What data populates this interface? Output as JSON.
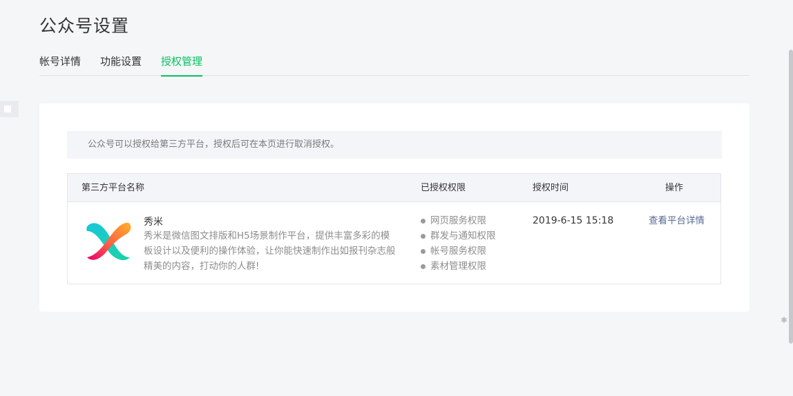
{
  "page": {
    "title": "公众号设置"
  },
  "tabs": [
    {
      "label": "帐号详情",
      "active": false
    },
    {
      "label": "功能设置",
      "active": false
    },
    {
      "label": "授权管理",
      "active": true
    }
  ],
  "notice": "公众号可以授权给第三方平台，授权后可在本页进行取消授权。",
  "table": {
    "headers": {
      "name": "第三方平台名称",
      "permissions": "已授权权限",
      "time": "授权时间",
      "operation": "操作"
    },
    "rows": [
      {
        "logo_icon": "xiumi-logo-icon",
        "name": "秀米",
        "description": "秀米是微信图文排版和H5场景制作平台，提供丰富多彩的模板设计以及便利的操作体验，让你能快速制作出如报刊杂志般精美的内容，打动你的人群!",
        "permissions": [
          "网页服务权限",
          "群发与通知权限",
          "帐号服务权限",
          "素材管理权限"
        ],
        "time": "2019-6-15 15:18",
        "action": "查看平台详情"
      }
    ]
  },
  "icons": {
    "side_handle": "sidebar-toggle-icon",
    "pin": "pin-icon"
  },
  "colors": {
    "accent": "#07c160",
    "link": "#576b95",
    "background": "#f4f6f8"
  }
}
